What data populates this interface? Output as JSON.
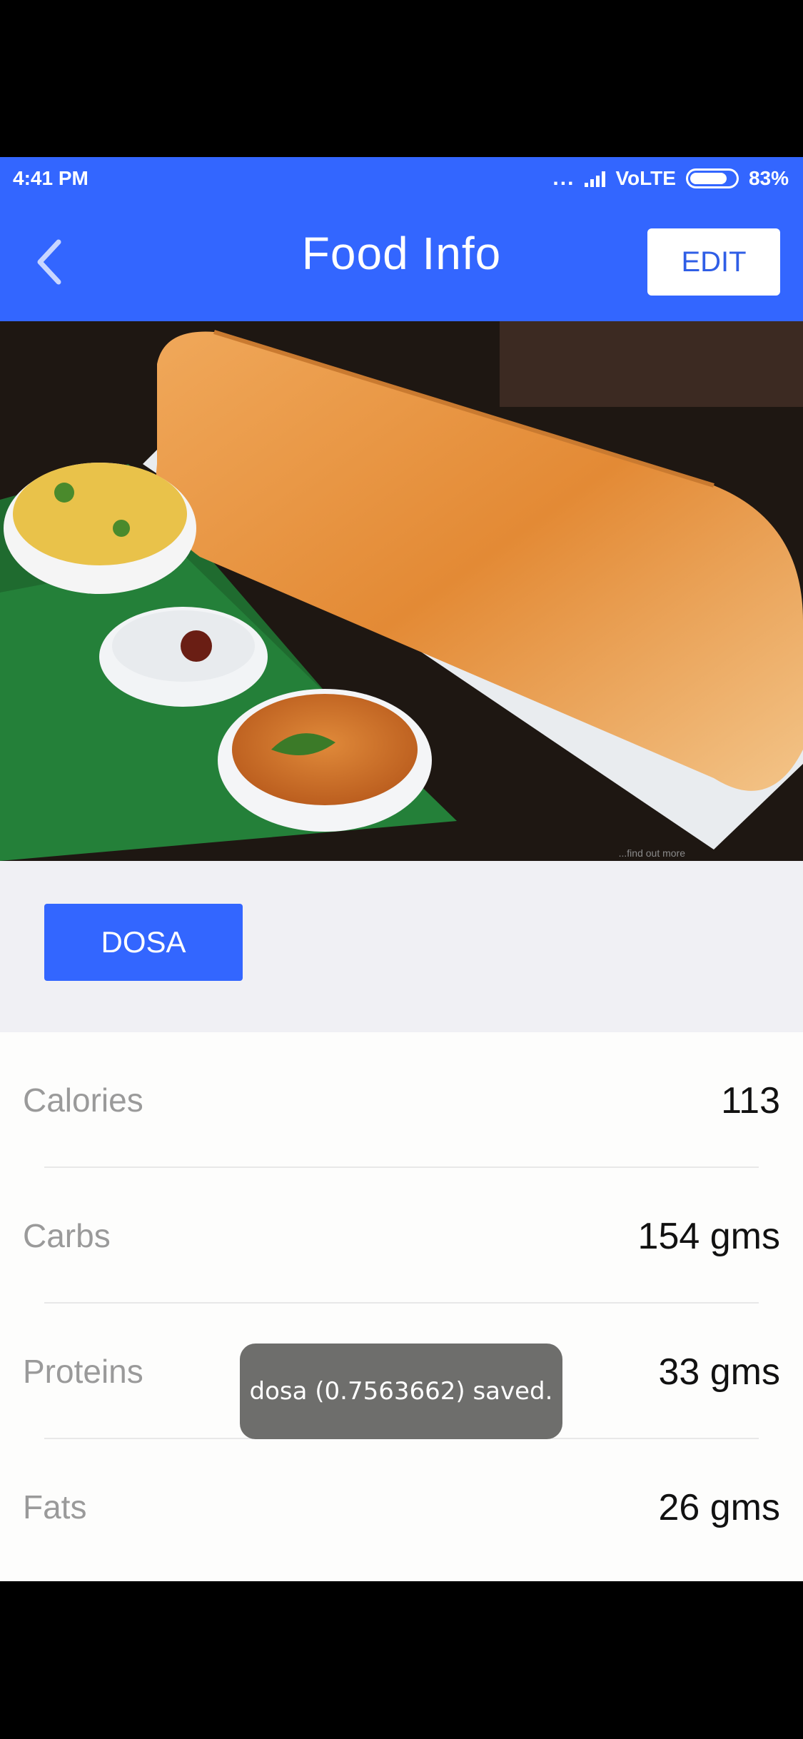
{
  "status_bar": {
    "time": "4:41 PM",
    "dots": "...",
    "network": "VoLTE",
    "battery": "83%",
    "battery_level": 0.83
  },
  "header": {
    "back_icon": "chevron-left-icon",
    "title": "Food Info",
    "edit_label": "EDIT"
  },
  "photo": {
    "description_icon": "food-photo",
    "watermark": "...find out more"
  },
  "food": {
    "name": "DOSA"
  },
  "nutrition": [
    {
      "label": "Calories",
      "value": "113"
    },
    {
      "label": "Carbs",
      "value": "154 gms"
    },
    {
      "label": "Proteins",
      "value": "33 gms"
    },
    {
      "label": "Fats",
      "value": "26 gms"
    }
  ],
  "toast": {
    "message": "dosa (0.7563662) saved."
  },
  "colors": {
    "primary": "#3366ff",
    "background": "#f0f0f4",
    "toast_bg": "#6e6e6c",
    "label_gray": "#9a9a9a"
  }
}
